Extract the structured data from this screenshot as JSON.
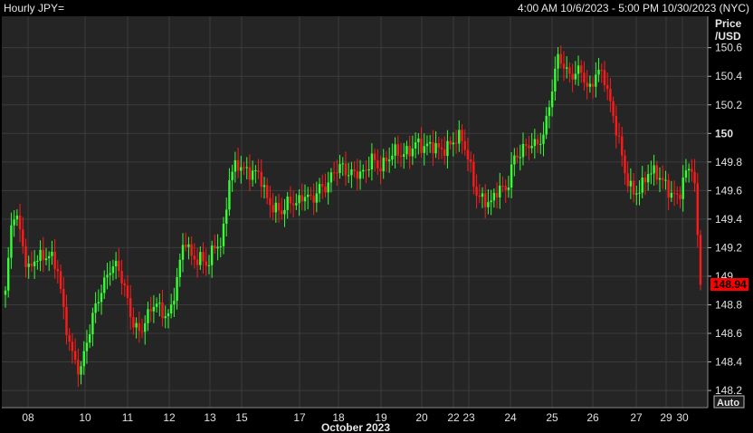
{
  "window": {
    "title": "Hourly JPY=",
    "date_range": "4:00 AM 10/6/2023 - 5:00 PM 10/30/2023 (NYC)"
  },
  "colors": {
    "background": "#000000",
    "plot_background": "#252525",
    "grid": "#3c3c3c",
    "up": "#33ff33",
    "down": "#ff1a1a",
    "last_price_bg": "#ff0000"
  },
  "chart_data": {
    "type": "candlestick",
    "y_axis_label_line1": "Price",
    "y_axis_label_line2": "/USD",
    "y_ticks": [
      "150.6",
      "150.4",
      "150.2",
      "150",
      "149.8",
      "149.6",
      "149.4",
      "149.2",
      "149",
      "148.8",
      "148.6",
      "148.4",
      "148.2"
    ],
    "y_tick_values": [
      150.6,
      150.4,
      150.2,
      150.0,
      149.8,
      149.6,
      149.4,
      149.2,
      149.0,
      148.8,
      148.6,
      148.4,
      148.2
    ],
    "ylim": [
      148.08,
      150.82
    ],
    "x_tick_labels": [
      "08",
      "10",
      "11",
      "12",
      "13",
      "15",
      "17",
      "18",
      "19",
      "20",
      "22",
      "23",
      "24",
      "25",
      "26",
      "27",
      "29",
      "30"
    ],
    "x_month_label": "October 2023",
    "last_price": "148.94",
    "auto_label": "Auto",
    "grid": true,
    "segments": [
      {
        "date": "08",
        "points": [
          148.88,
          149.45,
          149.3,
          149.05,
          149.15,
          149.12
        ]
      },
      {
        "date": "10",
        "points": [
          149.12,
          149.05,
          148.7,
          148.45,
          148.3,
          148.55,
          148.8,
          148.95,
          149.05
        ]
      },
      {
        "date": "11",
        "points": [
          149.05,
          148.9,
          148.7,
          148.62,
          148.7,
          148.8,
          148.75
        ]
      },
      {
        "date": "12",
        "points": [
          148.75,
          149.0,
          149.25,
          149.1,
          149.15,
          149.1,
          149.2
        ]
      },
      {
        "date": "13",
        "points": [
          149.2,
          149.7,
          149.82,
          149.75,
          149.7
        ]
      },
      {
        "date": "15",
        "points": [
          149.7,
          149.55,
          149.5,
          149.45,
          149.5
        ]
      },
      {
        "date": "17",
        "points": [
          149.5,
          149.6,
          149.55,
          149.6
        ]
      },
      {
        "date": "18",
        "points": [
          149.6,
          149.75,
          149.8,
          149.72,
          149.7
        ]
      },
      {
        "date": "19",
        "points": [
          149.7,
          149.85,
          149.78,
          149.8,
          149.85
        ]
      },
      {
        "date": "20",
        "points": [
          149.85,
          149.9,
          149.95,
          149.88,
          149.9
        ]
      },
      {
        "date": "22",
        "points": [
          149.9,
          149.92,
          149.95
        ]
      },
      {
        "date": "23",
        "points": [
          149.95,
          149.8,
          149.6,
          149.55,
          149.5,
          149.6
        ]
      },
      {
        "date": "24",
        "points": [
          149.6,
          149.85,
          149.88,
          149.9
        ]
      },
      {
        "date": "25",
        "points": [
          149.9,
          150.0,
          150.3,
          150.55,
          150.4
        ]
      },
      {
        "date": "26",
        "points": [
          150.4,
          150.48,
          150.3,
          150.4
        ]
      },
      {
        "date": "27",
        "points": [
          150.4,
          150.2,
          150.0,
          149.7,
          149.55,
          149.6,
          149.75
        ]
      },
      {
        "date": "29",
        "points": [
          149.75,
          149.65,
          149.55
        ]
      },
      {
        "date": "30",
        "points": [
          149.55,
          149.75,
          149.8,
          148.94
        ]
      }
    ]
  }
}
